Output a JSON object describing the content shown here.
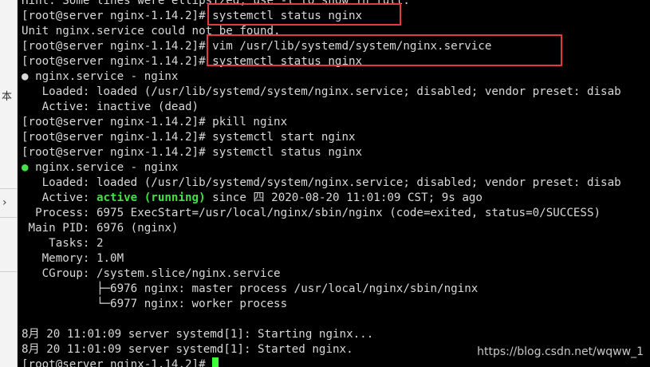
{
  "gutter": {
    "char": "本",
    "arrow": "›"
  },
  "terminal": {
    "lines": [
      {
        "text": "Hint: Some lines were ellipsized, use -l to show in full."
      },
      {
        "text": "[root@server nginx-1.14.2]# systemctl status nginx"
      },
      {
        "text": "Unit nginx.service could not be found."
      },
      {
        "text": "[root@server nginx-1.14.2]# vim /usr/lib/systemd/system/nginx.service"
      },
      {
        "text": "[root@server nginx-1.14.2]# systemctl status nginx"
      },
      {
        "bullet": "●",
        "text": " nginx.service - nginx"
      },
      {
        "text": "   Loaded: loaded (/usr/lib/systemd/system/nginx.service; disabled; vendor preset: disab"
      },
      {
        "text": "   Active: inactive (dead)"
      },
      {
        "text": "[root@server nginx-1.14.2]# pkill nginx"
      },
      {
        "text": "[root@server nginx-1.14.2]# systemctl start nginx"
      },
      {
        "text": "[root@server nginx-1.14.2]# systemctl status nginx"
      },
      {
        "bullet": "●",
        "bullet_green": true,
        "text": " nginx.service - nginx"
      },
      {
        "text": "   Loaded: loaded (/usr/lib/systemd/system/nginx.service; disabled; vendor preset: disab"
      },
      {
        "prefix": "   Active: ",
        "highlight": "active (running)",
        "text": " since 四 2020-08-20 11:01:09 CST; 9s ago"
      },
      {
        "text": "  Process: 6975 ExecStart=/usr/local/nginx/sbin/nginx (code=exited, status=0/SUCCESS)"
      },
      {
        "text": " Main PID: 6976 (nginx)"
      },
      {
        "text": "    Tasks: 2"
      },
      {
        "text": "   Memory: 1.0M"
      },
      {
        "text": "   CGroup: /system.slice/nginx.service"
      },
      {
        "text": "           ├─6976 nginx: master process /usr/local/nginx/sbin/nginx"
      },
      {
        "text": "           └─6977 nginx: worker process"
      },
      {
        "text": ""
      },
      {
        "text": "8月 20 11:01:09 server systemd[1]: Starting nginx..."
      },
      {
        "text": "8月 20 11:01:09 server systemd[1]: Started nginx."
      },
      {
        "text": "[root@server nginx-1.14.2]# ",
        "cursor": true
      }
    ]
  },
  "colors": {
    "background": "#000000",
    "foreground": "#d8d8d8",
    "green": "#45e045",
    "cursor": "#3cff3c",
    "annotation_red": "#e23b3b"
  },
  "watermark": "https://blog.csdn.net/wqww_1"
}
